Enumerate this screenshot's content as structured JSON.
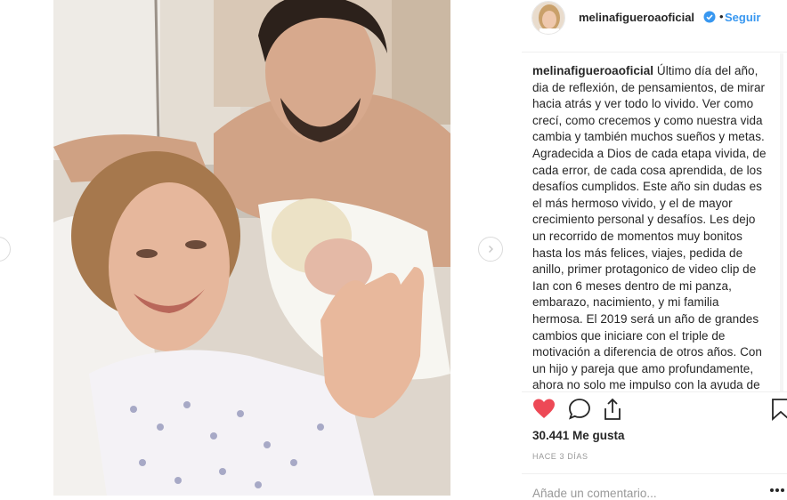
{
  "post": {
    "username": "melinafigueroaoficial",
    "follow_label": "Seguir",
    "separator": "•",
    "caption_user": "melinafigueroaoficial",
    "caption_text": "Último día del año, dia de reflexión, de pensamientos, de mirar hacia atrás y ver todo lo vivido. Ver como crecí, como crecemos y como nuestra vida cambia y también muchos sueños y metas. Agradecida a Dios de cada etapa vivida, de cada error, de cada cosa aprendida, de los desafíos cumplidos. Este año sin dudas es el más hermoso vivido, y el de mayor crecimiento personal y desafíos. Les dejo un recorrido de momentos muy bonitos hasta los más felices, viajes, pedida de anillo, primer protagonico de video clip de Ian con 6 meses dentro de mi panza, embarazo, nacimiento, y mi familia hermosa. El 2019 será un año de grandes cambios que iniciare con el triple de motivación a diferencia de otros años. Con un hijo y pareja que amo profundamente, ahora no solo me impulso con la ayuda de Dios sino también con la motivación de mi familia.",
    "likes": "30.441 Me gusta",
    "time_ago": "HACE 3 DÍAS",
    "comment_placeholder": "Añade un comentario..."
  },
  "colors": {
    "accent": "#3897f0",
    "like_red": "#ed4956",
    "text": "#262626",
    "muted": "#999999"
  },
  "icons": {
    "verified": "verified-badge-icon",
    "like": "heart-icon",
    "comment": "comment-icon",
    "share": "share-icon",
    "save": "bookmark-icon",
    "more": "more-options-icon",
    "prev": "chevron-left-icon",
    "next": "chevron-right-icon"
  }
}
